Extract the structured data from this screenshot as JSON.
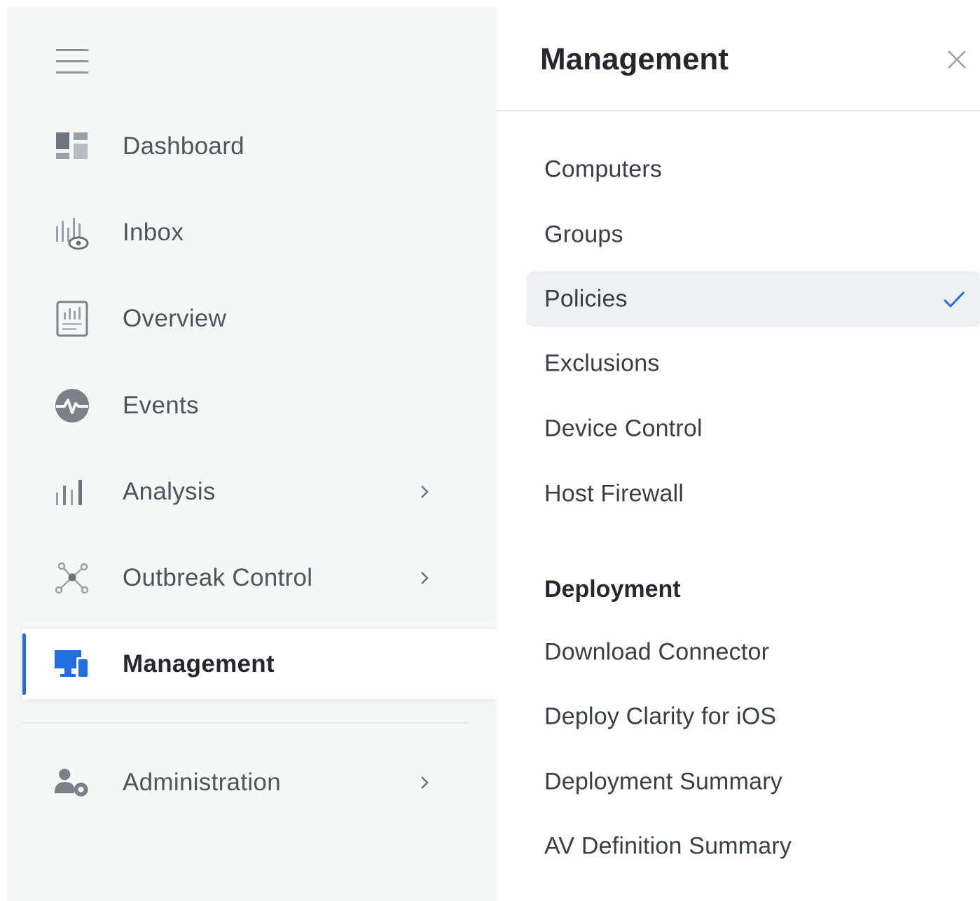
{
  "sidebar": {
    "menu_icon": "hamburger-menu-icon",
    "items": [
      {
        "label": "Dashboard",
        "icon": "dashboard-icon"
      },
      {
        "label": "Inbox",
        "icon": "inbox-icon"
      },
      {
        "label": "Overview",
        "icon": "overview-icon"
      },
      {
        "label": "Events",
        "icon": "events-icon"
      },
      {
        "label": "Analysis",
        "icon": "analysis-icon",
        "has_submenu": true
      },
      {
        "label": "Outbreak Control",
        "icon": "outbreak-control-icon",
        "has_submenu": true
      },
      {
        "label": "Management",
        "icon": "management-icon",
        "active": true
      },
      {
        "label": "Administration",
        "icon": "administration-icon",
        "has_submenu": true
      }
    ]
  },
  "panel": {
    "title": "Management",
    "close_icon": "close-icon",
    "items": [
      {
        "label": "Computers"
      },
      {
        "label": "Groups"
      },
      {
        "label": "Policies",
        "selected": true
      },
      {
        "label": "Exclusions"
      },
      {
        "label": "Device Control"
      },
      {
        "label": "Host Firewall"
      }
    ],
    "section": {
      "heading": "Deployment",
      "items": [
        {
          "label": "Download Connector"
        },
        {
          "label": "Deploy Clarity for iOS"
        },
        {
          "label": "Deployment Summary"
        },
        {
          "label": "AV Definition Summary"
        }
      ]
    }
  },
  "colors": {
    "accent": "#1f6fe0",
    "sidebar_bg": "#f6f7f7",
    "selected_bg": "#eef0f2",
    "text": "#3a3f45",
    "icon_gray": "#8e959b"
  }
}
